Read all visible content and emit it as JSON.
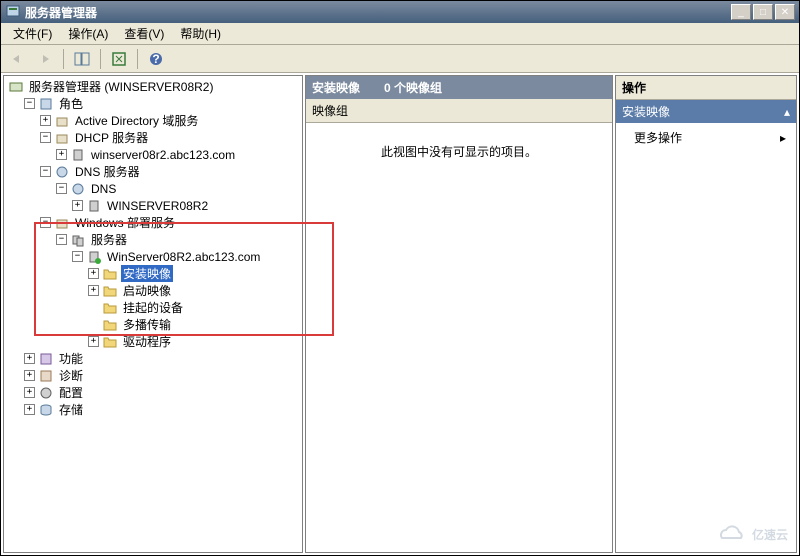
{
  "window": {
    "title": "服务器管理器"
  },
  "menu": {
    "file": "文件(F)",
    "action": "操作(A)",
    "view": "查看(V)",
    "help": "帮助(H)"
  },
  "toolbar": {
    "back": "←",
    "forward": "→"
  },
  "tree": {
    "root": "服务器管理器 (WINSERVER08R2)",
    "roles": "角色",
    "ad": "Active Directory 域服务",
    "dhcp": "DHCP 服务器",
    "dhcp_node": "winserver08r2.abc123.com",
    "dns": "DNS 服务器",
    "dns_sub": "DNS",
    "dns_host": "WINSERVER08R2",
    "wds": "Windows 部署服务",
    "servers": "服务器",
    "wds_host": "WinServer08R2.abc123.com",
    "install_img": "安装映像",
    "boot_img": "启动映像",
    "pending": "挂起的设备",
    "multicast": "多播传输",
    "drivers": "驱动程序",
    "features": "功能",
    "diag": "诊断",
    "config": "配置",
    "storage": "存储"
  },
  "mid": {
    "title": "安装映像",
    "count": "0 个映像组",
    "col": "映像组",
    "empty": "此视图中没有可显示的项目。"
  },
  "right": {
    "title": "操作",
    "section": "安装映像",
    "more": "更多操作"
  },
  "watermark": "亿速云"
}
